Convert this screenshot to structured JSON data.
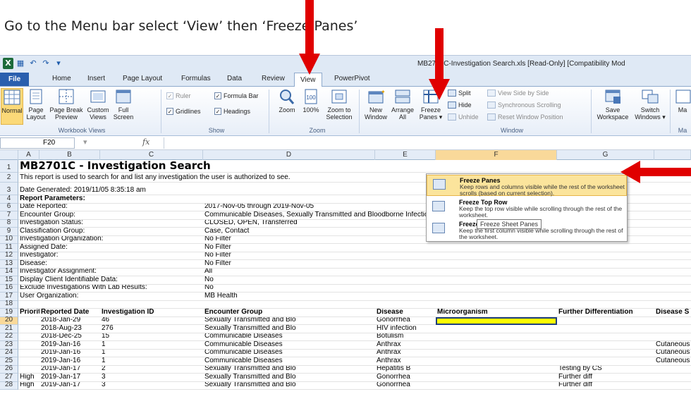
{
  "instruction": "Go to the Menu bar select ‘View’ then ‘Freeze Panes’",
  "window_title": "MB2701C-Investigation Search.xls  [Read-Only]  [Compatibility Mod",
  "tabs": [
    "File",
    "Home",
    "Insert",
    "Page Layout",
    "Formulas",
    "Data",
    "Review",
    "View",
    "PowerPivot"
  ],
  "ribbon": {
    "normal": "Normal",
    "page_layout": "Page\nLayout",
    "page_break": "Page Break\nPreview",
    "custom_views": "Custom\nViews",
    "full_screen": "Full\nScreen",
    "workbook_views_group": "Workbook Views",
    "ruler": "Ruler",
    "formula_bar": "Formula Bar",
    "gridlines": "Gridlines",
    "headings": "Headings",
    "show_group": "Show",
    "zoom": "Zoom",
    "zoom100": "100%",
    "zoom_sel": "Zoom to\nSelection",
    "zoom_group": "Zoom",
    "new_window": "New\nWindow",
    "arrange_all": "Arrange\nAll",
    "freeze_panes": "Freeze\nPanes ▾",
    "split": "Split",
    "hide": "Hide",
    "unhide": "Unhide",
    "view_side": "View Side by Side",
    "sync_scroll": "Synchronous Scrolling",
    "reset_window": "Reset Window Position",
    "window_group": "Window",
    "save_workspace": "Save\nWorkspace",
    "switch_windows": "Switch\nWindows ▾",
    "macros": "Ma",
    "macros_group": "Ma"
  },
  "name_box": "F20",
  "fx": "fx",
  "columns": [
    "A",
    "B",
    "C",
    "D",
    "E",
    "F",
    "G"
  ],
  "rows": [
    {
      "n": "1",
      "cells": [
        {
          "col": "A",
          "text": "MB2701C - Investigation Search",
          "style": "title"
        }
      ]
    },
    {
      "n": "2",
      "cells": [
        {
          "col": "A",
          "text": "This report is used to search for and list any investigation the user is authorized to see."
        }
      ]
    },
    {
      "n": "3",
      "cells": [
        {
          "col": "A",
          "text": "Date Generated: 2019/11/05  8:35:18 am"
        }
      ]
    },
    {
      "n": "4",
      "cells": [
        {
          "col": "A",
          "text": "Report Parameters:",
          "style": "b"
        }
      ]
    },
    {
      "n": "6",
      "cells": [
        {
          "col": "A",
          "text": "Date Reported:"
        },
        {
          "col": "D",
          "text": "2017-Nov-05 through 2019-Nov-05"
        }
      ]
    },
    {
      "n": "7",
      "cells": [
        {
          "col": "A",
          "text": "Encounter Group:"
        },
        {
          "col": "D",
          "text": "Communicable Diseases, Sexually Transmitted and Bloodborne Infections, Tuberculosis"
        }
      ]
    },
    {
      "n": "8",
      "cells": [
        {
          "col": "A",
          "text": "Investigation Status:"
        },
        {
          "col": "D",
          "text": "CLOSED, OPEN, Transferred"
        }
      ]
    },
    {
      "n": "9",
      "cells": [
        {
          "col": "A",
          "text": "Classification Group:"
        },
        {
          "col": "D",
          "text": "Case, Contact"
        }
      ]
    },
    {
      "n": "10",
      "cells": [
        {
          "col": "A",
          "text": "Investigation Organization:"
        },
        {
          "col": "D",
          "text": "No Filter"
        }
      ]
    },
    {
      "n": "11",
      "cells": [
        {
          "col": "A",
          "text": "Assigned Date:"
        },
        {
          "col": "D",
          "text": "No Filter"
        }
      ]
    },
    {
      "n": "12",
      "cells": [
        {
          "col": "A",
          "text": "Investigator:"
        },
        {
          "col": "D",
          "text": "No Filter"
        }
      ]
    },
    {
      "n": "13",
      "cells": [
        {
          "col": "A",
          "text": "Disease:"
        },
        {
          "col": "D",
          "text": "No Filter"
        }
      ]
    },
    {
      "n": "14",
      "cells": [
        {
          "col": "A",
          "text": "Investigator Assignment:"
        },
        {
          "col": "D",
          "text": "All"
        }
      ]
    },
    {
      "n": "15",
      "cells": [
        {
          "col": "A",
          "text": "Display Client Identifiable Data:"
        },
        {
          "col": "D",
          "text": "No"
        }
      ]
    },
    {
      "n": "16",
      "cells": [
        {
          "col": "A",
          "text": "Exclude Investigations With Lab Results:"
        },
        {
          "col": "D",
          "text": "No"
        }
      ]
    },
    {
      "n": "17",
      "cells": [
        {
          "col": "A",
          "text": "User Organization:"
        },
        {
          "col": "D",
          "text": "MB Health"
        }
      ]
    },
    {
      "n": "18",
      "cells": []
    },
    {
      "n": "19",
      "cells": [
        {
          "col": "A",
          "text": "Priority",
          "style": "b"
        },
        {
          "col": "B",
          "text": "Reported Date",
          "style": "b"
        },
        {
          "col": "C",
          "text": "Investigation  ID",
          "style": "b"
        },
        {
          "col": "D",
          "text": "Encounter Group",
          "style": "b"
        },
        {
          "col": "E",
          "text": "Disease",
          "style": "b"
        },
        {
          "col": "F",
          "text": "Microorganism",
          "style": "b"
        },
        {
          "col": "G",
          "text": "Further Differentiation",
          "style": "b"
        },
        {
          "col": "H",
          "text": "Disease S",
          "style": "b"
        }
      ]
    },
    {
      "n": "20",
      "cells": [
        {
          "col": "B",
          "text": "2018-Jan-29"
        },
        {
          "col": "C",
          "text": "46"
        },
        {
          "col": "D",
          "text": "Sexually Transmitted and Blo"
        },
        {
          "col": "E",
          "text": "Gonorrhea"
        }
      ]
    },
    {
      "n": "21",
      "cells": [
        {
          "col": "B",
          "text": "2018-Aug-23"
        },
        {
          "col": "C",
          "text": "276"
        },
        {
          "col": "D",
          "text": "Sexually Transmitted and Blo"
        },
        {
          "col": "E",
          "text": "HIV infection"
        }
      ]
    },
    {
      "n": "22",
      "cells": [
        {
          "col": "B",
          "text": "2018-Dec-25"
        },
        {
          "col": "C",
          "text": "15"
        },
        {
          "col": "D",
          "text": "Communicable Diseases"
        },
        {
          "col": "E",
          "text": "Botulism"
        }
      ]
    },
    {
      "n": "23",
      "cells": [
        {
          "col": "B",
          "text": "2019-Jan-16"
        },
        {
          "col": "C",
          "text": "1"
        },
        {
          "col": "D",
          "text": "Communicable Diseases"
        },
        {
          "col": "E",
          "text": "Anthrax"
        },
        {
          "col": "H",
          "text": "Cutaneous"
        }
      ]
    },
    {
      "n": "24",
      "cells": [
        {
          "col": "B",
          "text": "2019-Jan-16"
        },
        {
          "col": "C",
          "text": "1"
        },
        {
          "col": "D",
          "text": "Communicable Diseases"
        },
        {
          "col": "E",
          "text": "Anthrax"
        },
        {
          "col": "H",
          "text": "Cutaneous"
        }
      ]
    },
    {
      "n": "25",
      "cells": [
        {
          "col": "B",
          "text": "2019-Jan-16"
        },
        {
          "col": "C",
          "text": "1"
        },
        {
          "col": "D",
          "text": "Communicable Diseases"
        },
        {
          "col": "E",
          "text": "Anthrax"
        },
        {
          "col": "H",
          "text": "Cutaneous"
        }
      ]
    },
    {
      "n": "26",
      "cells": [
        {
          "col": "B",
          "text": "2019-Jan-17"
        },
        {
          "col": "C",
          "text": "2"
        },
        {
          "col": "D",
          "text": "Sexually Transmitted and Blo"
        },
        {
          "col": "E",
          "text": "Hepatitis B"
        },
        {
          "col": "G",
          "text": "Testing by CS"
        }
      ]
    },
    {
      "n": "27",
      "cells": [
        {
          "col": "A",
          "text": "High"
        },
        {
          "col": "B",
          "text": "2019-Jan-17"
        },
        {
          "col": "C",
          "text": "3"
        },
        {
          "col": "D",
          "text": "Sexually Transmitted and Blo"
        },
        {
          "col": "E",
          "text": "Gonorrhea"
        },
        {
          "col": "G",
          "text": "Further diff"
        }
      ]
    },
    {
      "n": "28",
      "cells": [
        {
          "col": "A",
          "text": "High"
        },
        {
          "col": "B",
          "text": "2019-Jan-17"
        },
        {
          "col": "C",
          "text": "3"
        },
        {
          "col": "D",
          "text": "Sexually Transmitted and Blo"
        },
        {
          "col": "E",
          "text": "Gonorrhea"
        },
        {
          "col": "G",
          "text": "Further diff"
        }
      ]
    }
  ],
  "dropdown": [
    {
      "title": "Freeze Panes",
      "desc": "Keep rows and columns visible while the rest of the worksheet scrolls (based on current selection)."
    },
    {
      "title": "Freeze Top Row",
      "desc": "Keep the top row visible while scrolling through the rest of the worksheet."
    },
    {
      "title": "Freeze First Column",
      "desc": "Keep the first column visible while scrolling through the rest of the worksheet."
    }
  ],
  "tooltip": "Freeze Sheet Panes",
  "colors": {
    "arrow": "#e00000",
    "file_tab": "#2a5fae",
    "highlight": "#fbe49c",
    "selected_cell": "#ffff00"
  }
}
